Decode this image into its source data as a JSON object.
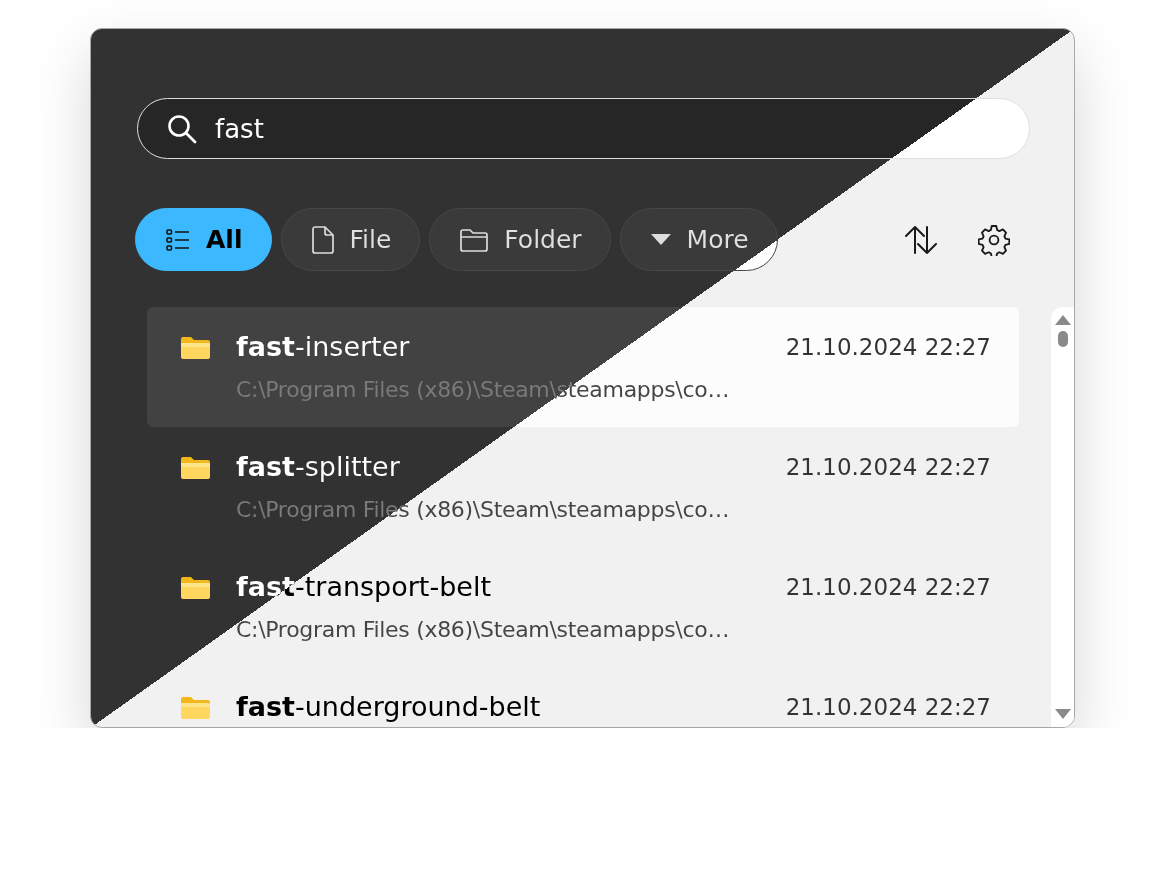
{
  "search": {
    "value": "fast"
  },
  "filters": [
    {
      "label": "All",
      "kind": "list",
      "selected": true
    },
    {
      "label": "File",
      "kind": "file",
      "selected": false
    },
    {
      "label": "Folder",
      "kind": "folder",
      "selected": false
    },
    {
      "label": "More",
      "kind": "dropdown",
      "selected": false
    }
  ],
  "results": [
    {
      "name": "**fast**-inserter",
      "path": "C:\\Program Files (x86)\\Steam\\steamapps\\co…",
      "date": "21.10.2024 22:27",
      "selected": true
    },
    {
      "name": "**fast**-splitter",
      "path": "C:\\Program Files (x86)\\Steam\\steamapps\\co…",
      "date": "21.10.2024 22:27",
      "selected": false
    },
    {
      "name": "**fast**-transport-belt",
      "path": "C:\\Program Files (x86)\\Steam\\steamapps\\co…",
      "date": "21.10.2024 22:27",
      "selected": false
    },
    {
      "name": "**fast**-underground-belt",
      "date": "21.10.2024 22:27",
      "selected": false
    }
  ]
}
